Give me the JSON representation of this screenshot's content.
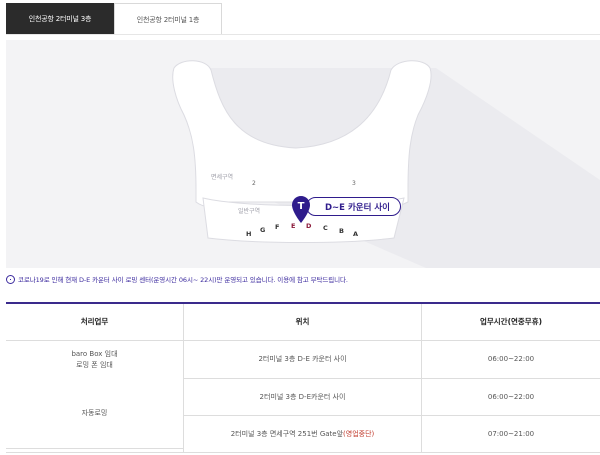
{
  "tabs": [
    {
      "label": "인천공항 2터미널 3층",
      "active": true
    },
    {
      "label": "인천공항 2터미널 1층",
      "active": false
    }
  ],
  "map": {
    "zone_duty_free": "면세구역",
    "zone_general": "일반구역",
    "gate_2": "2",
    "gate_3": "3",
    "counters": [
      "H",
      "G",
      "F",
      "E",
      "D",
      "C",
      "B",
      "A"
    ],
    "highlight_counters": [
      "E",
      "D"
    ],
    "pin_label": "D~E 카운터 사이",
    "pin_icon": "T",
    "accent_color": "#2f1c8c"
  },
  "notice": {
    "icon": "info-icon",
    "text": "코로나19로 인해 현재 D-E 카운터 사이 로밍 센터(운영시간 06시~ 22시)만 운영되고 있습니다. 이용에 참고 부탁드립니다."
  },
  "table": {
    "headers": [
      "처리업무",
      "위치",
      "업무시간(연중무휴)"
    ],
    "rows": [
      {
        "task_line1": "baro Box 임대",
        "task_line2": "로밍 폰 임대",
        "location": "2터미널 3층 D-E 카운터 사이",
        "hours": "06:00~22:00"
      },
      {
        "task": "자동로밍",
        "location": "2터미널 3층 D-E카운터 사이",
        "hours": "06:00~22:00"
      },
      {
        "task": "",
        "location_main": "2터미널 3층 면세구역 251번 Gate앞 ",
        "location_status": "(영업중단)",
        "hours": "07:00~21:00"
      }
    ]
  }
}
